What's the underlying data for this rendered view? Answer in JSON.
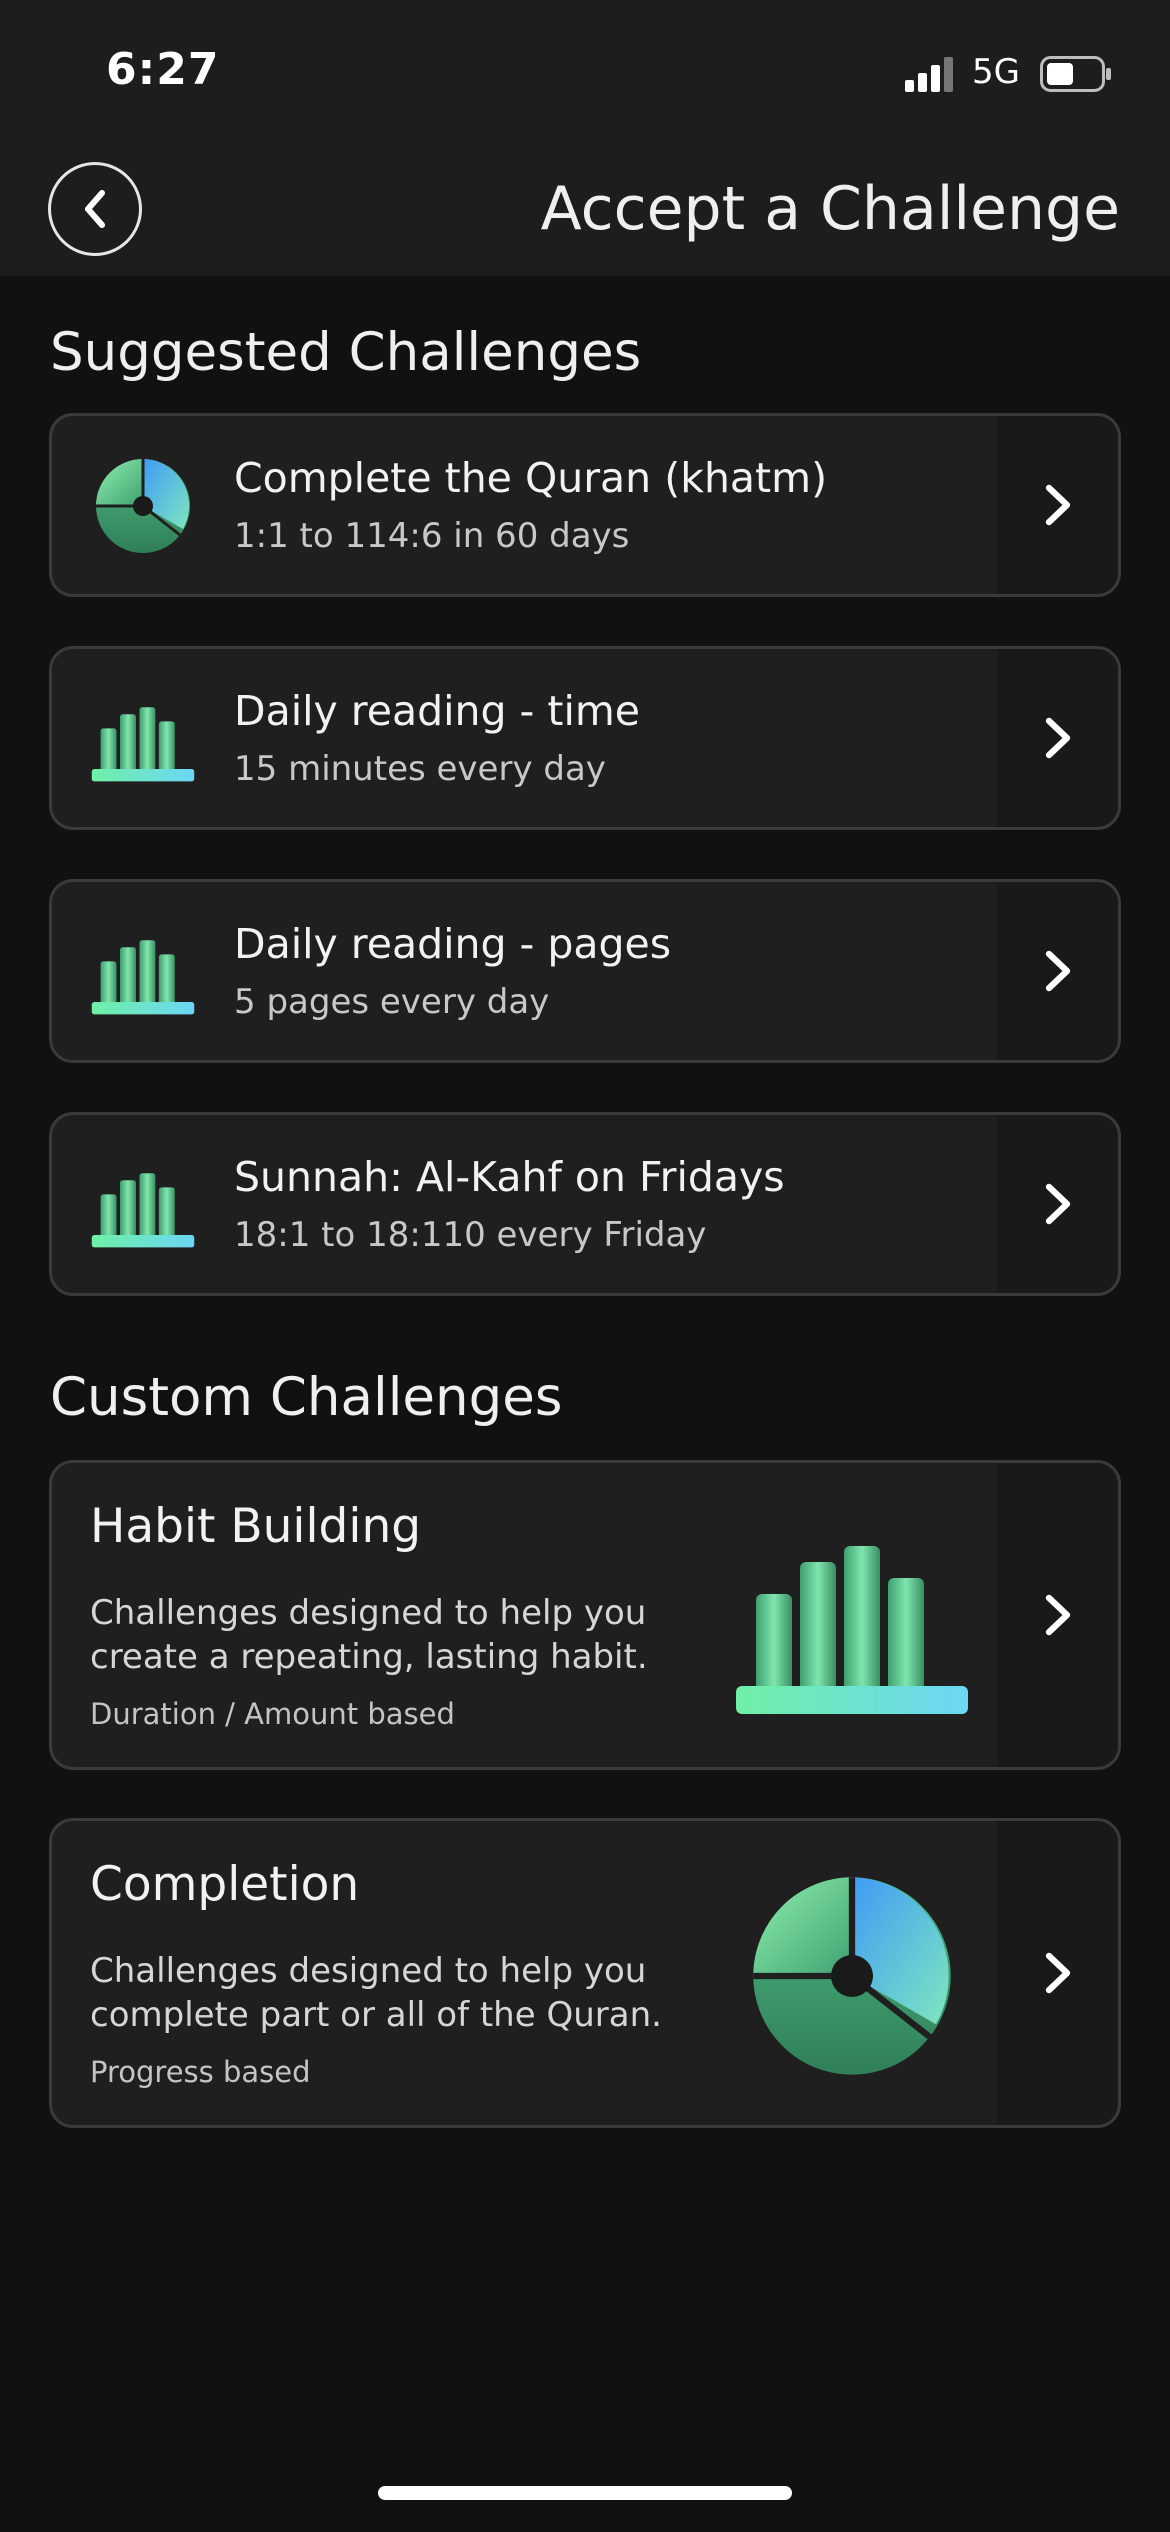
{
  "status_bar": {
    "time": "6:27",
    "network": "5G"
  },
  "header": {
    "title": "Accept a Challenge"
  },
  "suggested": {
    "title": "Suggested Challenges",
    "items": [
      {
        "title": "Complete the Quran (khatm)",
        "subtitle": "1:1 to 114:6 in 60 days",
        "icon": "pie-chart-icon"
      },
      {
        "title": "Daily reading - time",
        "subtitle": "15 minutes every day",
        "icon": "bar-chart-icon"
      },
      {
        "title": "Daily reading - pages",
        "subtitle": "5 pages every day",
        "icon": "bar-chart-icon"
      },
      {
        "title": "Sunnah: Al-Kahf on Fridays",
        "subtitle": "18:1 to 18:110 every Friday",
        "icon": "bar-chart-icon"
      }
    ]
  },
  "custom": {
    "title": "Custom Challenges",
    "items": [
      {
        "title": "Habit Building",
        "description": "Challenges designed to help you create a repeating, lasting habit.",
        "meta": "Duration / Amount based",
        "icon": "bar-chart-icon"
      },
      {
        "title": "Completion",
        "description": "Challenges designed to help you complete part or all of the Quran.",
        "meta": "Progress based",
        "icon": "pie-chart-icon"
      }
    ]
  },
  "colors": {
    "background": "#111111",
    "card": "#1f1f1f",
    "accent_green": "#5fd99a",
    "accent_blue": "#4aa8f0"
  }
}
